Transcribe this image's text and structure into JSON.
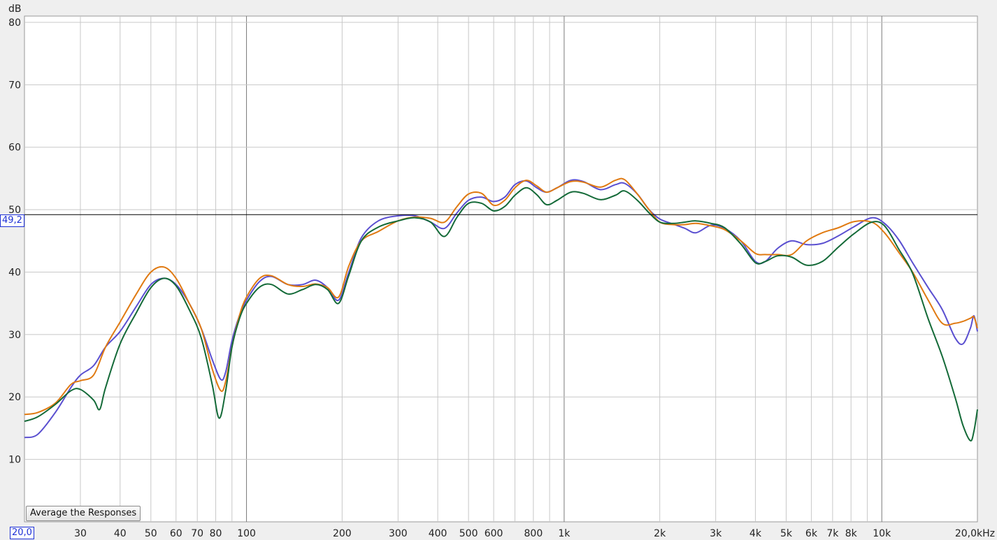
{
  "controls": {
    "average_label": "Average the Responses"
  },
  "cursor": {
    "y_readout": "49,2",
    "x_readout": "20,0",
    "y_value": 49.2
  },
  "colors": {
    "background": "#efefef",
    "plot_bg": "#ffffff",
    "grid": "#c8c8c8",
    "decade": "#7a7a7a",
    "cursor": "#000000"
  },
  "chart_data": {
    "type": "line",
    "xscale": "log",
    "xlim": [
      20,
      20000
    ],
    "ylim": [
      0,
      81
    ],
    "y_unit": "dB",
    "grid": true,
    "y_ticks": [
      10,
      20,
      30,
      40,
      50,
      60,
      70,
      80
    ],
    "x_ticks": [
      {
        "v": 30,
        "label": "30"
      },
      {
        "v": 40,
        "label": "40"
      },
      {
        "v": 50,
        "label": "50"
      },
      {
        "v": 60,
        "label": "60"
      },
      {
        "v": 70,
        "label": "70"
      },
      {
        "v": 80,
        "label": "80"
      },
      {
        "v": 100,
        "label": "100"
      },
      {
        "v": 200,
        "label": "200"
      },
      {
        "v": 300,
        "label": "300"
      },
      {
        "v": 400,
        "label": "400"
      },
      {
        "v": 500,
        "label": "500"
      },
      {
        "v": 600,
        "label": "600"
      },
      {
        "v": 800,
        "label": "800"
      },
      {
        "v": 1000,
        "label": "1k"
      },
      {
        "v": 2000,
        "label": "2k"
      },
      {
        "v": 3000,
        "label": "3k"
      },
      {
        "v": 4000,
        "label": "4k"
      },
      {
        "v": 5000,
        "label": "5k"
      },
      {
        "v": 6000,
        "label": "6k"
      },
      {
        "v": 7000,
        "label": "7k"
      },
      {
        "v": 8000,
        "label": "8k"
      },
      {
        "v": 10000,
        "label": "10k"
      },
      {
        "v": 20000,
        "label": "20,0kHz"
      }
    ],
    "series": [
      {
        "color": "#5a4fd0",
        "points": [
          [
            20,
            13.5
          ],
          [
            22,
            14
          ],
          [
            25,
            17.5
          ],
          [
            28,
            21.5
          ],
          [
            30,
            23.5
          ],
          [
            33,
            25
          ],
          [
            36,
            28
          ],
          [
            40,
            30.5
          ],
          [
            45,
            34.5
          ],
          [
            50,
            38
          ],
          [
            55,
            39
          ],
          [
            60,
            38
          ],
          [
            66,
            35
          ],
          [
            72,
            31
          ],
          [
            78,
            26
          ],
          [
            83,
            22.8
          ],
          [
            86,
            24
          ],
          [
            90,
            29
          ],
          [
            95,
            33
          ],
          [
            100,
            35.5
          ],
          [
            110,
            38.5
          ],
          [
            120,
            39.3
          ],
          [
            135,
            38
          ],
          [
            150,
            38
          ],
          [
            165,
            38.7
          ],
          [
            180,
            37.5
          ],
          [
            195,
            35.5
          ],
          [
            210,
            40
          ],
          [
            230,
            45.5
          ],
          [
            260,
            48.2
          ],
          [
            300,
            49
          ],
          [
            340,
            49
          ],
          [
            380,
            48
          ],
          [
            420,
            47
          ],
          [
            460,
            49.5
          ],
          [
            500,
            51.5
          ],
          [
            550,
            52
          ],
          [
            600,
            51.3
          ],
          [
            650,
            52
          ],
          [
            700,
            54
          ],
          [
            760,
            54.6
          ],
          [
            820,
            53.5
          ],
          [
            880,
            52.8
          ],
          [
            950,
            53.5
          ],
          [
            1050,
            54.7
          ],
          [
            1150,
            54.5
          ],
          [
            1300,
            53.2
          ],
          [
            1450,
            54
          ],
          [
            1550,
            54.2
          ],
          [
            1700,
            52.5
          ],
          [
            1850,
            50
          ],
          [
            2000,
            48.5
          ],
          [
            2200,
            47.7
          ],
          [
            2400,
            47
          ],
          [
            2600,
            46.3
          ],
          [
            2900,
            47.5
          ],
          [
            3200,
            47
          ],
          [
            3600,
            45
          ],
          [
            4000,
            41.7
          ],
          [
            4300,
            41.7
          ],
          [
            4700,
            43.8
          ],
          [
            5200,
            45
          ],
          [
            5800,
            44.4
          ],
          [
            6500,
            44.6
          ],
          [
            7300,
            45.8
          ],
          [
            8200,
            47.3
          ],
          [
            9300,
            48.7
          ],
          [
            10200,
            47.8
          ],
          [
            11300,
            45.2
          ],
          [
            12500,
            41.5
          ],
          [
            14000,
            37.5
          ],
          [
            15500,
            34
          ],
          [
            17000,
            29.5
          ],
          [
            18000,
            28.5
          ],
          [
            19000,
            31
          ],
          [
            19500,
            33
          ],
          [
            20000,
            30.5
          ]
        ]
      },
      {
        "color": "#e07a12",
        "points": [
          [
            20,
            17.2
          ],
          [
            22,
            17.5
          ],
          [
            25,
            19
          ],
          [
            28,
            22
          ],
          [
            30,
            22.6
          ],
          [
            33,
            23.5
          ],
          [
            36,
            28
          ],
          [
            40,
            32
          ],
          [
            45,
            36.5
          ],
          [
            50,
            40
          ],
          [
            55,
            40.8
          ],
          [
            60,
            39
          ],
          [
            66,
            35
          ],
          [
            72,
            31
          ],
          [
            78,
            24.5
          ],
          [
            83,
            21
          ],
          [
            86,
            22.5
          ],
          [
            90,
            28
          ],
          [
            95,
            33
          ],
          [
            100,
            36
          ],
          [
            110,
            39
          ],
          [
            120,
            39.4
          ],
          [
            135,
            38
          ],
          [
            150,
            37.7
          ],
          [
            165,
            38.1
          ],
          [
            180,
            37.5
          ],
          [
            195,
            36
          ],
          [
            210,
            41
          ],
          [
            230,
            45
          ],
          [
            260,
            46.5
          ],
          [
            300,
            48.2
          ],
          [
            340,
            48.8
          ],
          [
            380,
            48.6
          ],
          [
            420,
            48
          ],
          [
            460,
            50.5
          ],
          [
            500,
            52.5
          ],
          [
            550,
            52.6
          ],
          [
            600,
            50.7
          ],
          [
            650,
            51.5
          ],
          [
            700,
            53.5
          ],
          [
            760,
            54.7
          ],
          [
            820,
            53.8
          ],
          [
            880,
            52.8
          ],
          [
            950,
            53.5
          ],
          [
            1050,
            54.5
          ],
          [
            1150,
            54.4
          ],
          [
            1300,
            53.6
          ],
          [
            1450,
            54.7
          ],
          [
            1550,
            54.8
          ],
          [
            1700,
            52.5
          ],
          [
            1850,
            50
          ],
          [
            2000,
            48
          ],
          [
            2200,
            47.6
          ],
          [
            2400,
            47.6
          ],
          [
            2600,
            47.8
          ],
          [
            2900,
            47.4
          ],
          [
            3200,
            46.8
          ],
          [
            3600,
            45
          ],
          [
            4000,
            43
          ],
          [
            4300,
            42.8
          ],
          [
            4700,
            42.8
          ],
          [
            5200,
            42.8
          ],
          [
            5800,
            45
          ],
          [
            6500,
            46.3
          ],
          [
            7300,
            47.1
          ],
          [
            8200,
            48.1
          ],
          [
            9300,
            48
          ],
          [
            10200,
            46.3
          ],
          [
            11300,
            43.2
          ],
          [
            12500,
            40
          ],
          [
            14000,
            35.5
          ],
          [
            15500,
            31.8
          ],
          [
            17000,
            31.8
          ],
          [
            18000,
            32.1
          ],
          [
            19000,
            32.6
          ],
          [
            19500,
            32.8
          ],
          [
            20000,
            31
          ]
        ]
      },
      {
        "color": "#146a38",
        "points": [
          [
            20,
            16.1
          ],
          [
            22,
            16.8
          ],
          [
            25,
            18.8
          ],
          [
            28,
            21
          ],
          [
            30,
            21.2
          ],
          [
            33,
            19.5
          ],
          [
            34.5,
            18
          ],
          [
            36,
            21.5
          ],
          [
            40,
            28.5
          ],
          [
            45,
            33.5
          ],
          [
            50,
            37.5
          ],
          [
            55,
            39
          ],
          [
            60,
            37.8
          ],
          [
            66,
            34
          ],
          [
            72,
            29.5
          ],
          [
            78,
            22
          ],
          [
            82,
            16.6
          ],
          [
            86,
            21
          ],
          [
            90,
            28
          ],
          [
            95,
            32.5
          ],
          [
            100,
            35
          ],
          [
            110,
            37.6
          ],
          [
            120,
            38
          ],
          [
            135,
            36.5
          ],
          [
            150,
            37.2
          ],
          [
            165,
            38
          ],
          [
            180,
            37.2
          ],
          [
            195,
            35
          ],
          [
            210,
            39.5
          ],
          [
            230,
            45
          ],
          [
            260,
            47.2
          ],
          [
            300,
            48.2
          ],
          [
            340,
            48.7
          ],
          [
            380,
            48
          ],
          [
            420,
            45.7
          ],
          [
            460,
            48.8
          ],
          [
            500,
            51
          ],
          [
            550,
            51
          ],
          [
            600,
            49.8
          ],
          [
            650,
            50.5
          ],
          [
            700,
            52.3
          ],
          [
            760,
            53.5
          ],
          [
            820,
            52.4
          ],
          [
            880,
            50.8
          ],
          [
            950,
            51.5
          ],
          [
            1050,
            52.8
          ],
          [
            1150,
            52.6
          ],
          [
            1300,
            51.6
          ],
          [
            1450,
            52.3
          ],
          [
            1550,
            53
          ],
          [
            1700,
            51.5
          ],
          [
            1850,
            49.5
          ],
          [
            2000,
            48
          ],
          [
            2200,
            47.8
          ],
          [
            2400,
            48
          ],
          [
            2600,
            48.2
          ],
          [
            2900,
            47.8
          ],
          [
            3200,
            47.1
          ],
          [
            3600,
            44.5
          ],
          [
            4000,
            41.5
          ],
          [
            4300,
            41.7
          ],
          [
            4700,
            42.6
          ],
          [
            5200,
            42.4
          ],
          [
            5800,
            41.1
          ],
          [
            6500,
            41.7
          ],
          [
            7300,
            44
          ],
          [
            8200,
            46.2
          ],
          [
            9300,
            48
          ],
          [
            10200,
            47.4
          ],
          [
            11300,
            43.7
          ],
          [
            12500,
            39.8
          ],
          [
            14000,
            32.5
          ],
          [
            15500,
            26.5
          ],
          [
            17000,
            20
          ],
          [
            18000,
            15.5
          ],
          [
            19000,
            13
          ],
          [
            19500,
            14.5
          ],
          [
            20000,
            18
          ]
        ]
      }
    ]
  }
}
